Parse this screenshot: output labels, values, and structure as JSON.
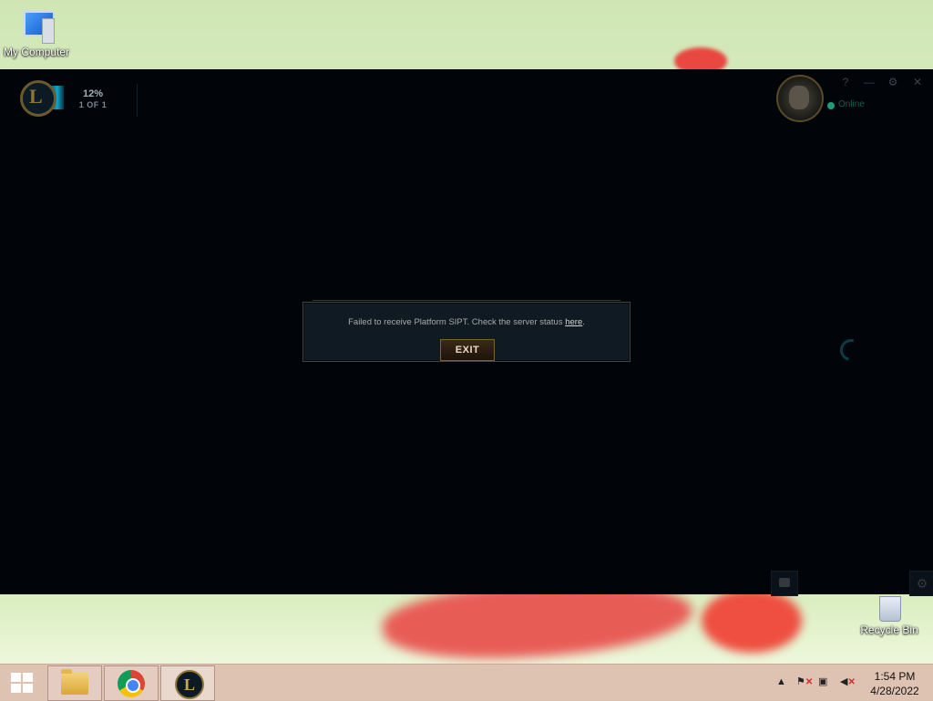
{
  "desktop": {
    "icons": [
      {
        "label": "My Computer"
      },
      {
        "label": "Recycle Bin"
      }
    ]
  },
  "client": {
    "patch": {
      "percent": "12%",
      "count": "1 OF 1"
    },
    "status": "Online",
    "window_buttons": {
      "help": "?",
      "minimize": "—",
      "settings": "⚙",
      "close": "✕"
    }
  },
  "dialog": {
    "message": "Failed to receive Platform SIPT. Check the server status ",
    "link": "here",
    "suffix": ".",
    "button": "EXIT"
  },
  "taskbar": {
    "apps": [
      "File Explorer",
      "Google Chrome",
      "League of Legends"
    ],
    "tray_up": "▲",
    "time": "1:54 PM",
    "date": "4/28/2022"
  },
  "colors": {
    "accent_gold": "#7b6330",
    "status_green": "#1d9e7a"
  }
}
